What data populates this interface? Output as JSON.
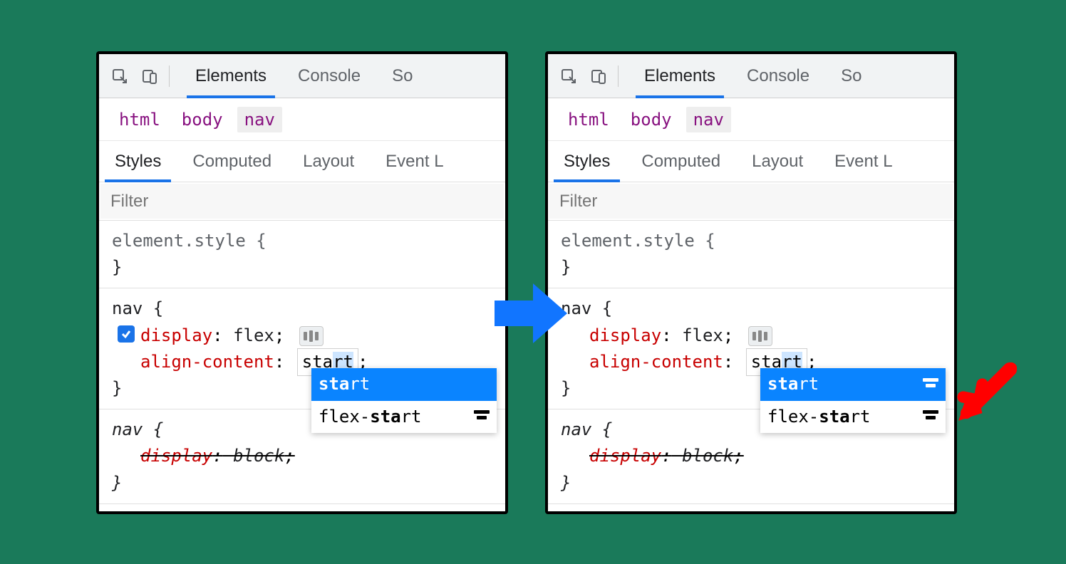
{
  "toolbar": {
    "tabs": [
      "Elements",
      "Console",
      "So"
    ],
    "active": 0
  },
  "breadcrumb": [
    "html",
    "body",
    "nav"
  ],
  "subtabs": [
    "Styles",
    "Computed",
    "Layout",
    "Event L"
  ],
  "filter_placeholder": "Filter",
  "rules": {
    "element_style": "element.style {",
    "close_brace": "}",
    "nav_selector": "nav {",
    "display_prop": "display",
    "display_val": "flex",
    "align_prop": "align-content",
    "align_val_prefix": "sta",
    "align_val_suffix": "rt",
    "semicolon": ";",
    "colon": ":",
    "ua_nav_selector": "nav {",
    "ua_display_prop": "display",
    "ua_display_val": "block"
  },
  "autocomplete": {
    "items": [
      {
        "prefix": "sta",
        "suffix": "rt",
        "selected": true
      },
      {
        "prefix_plain": "flex-",
        "bold": "sta",
        "suffix": "rt",
        "selected": false
      }
    ]
  },
  "right_has_icons": true
}
